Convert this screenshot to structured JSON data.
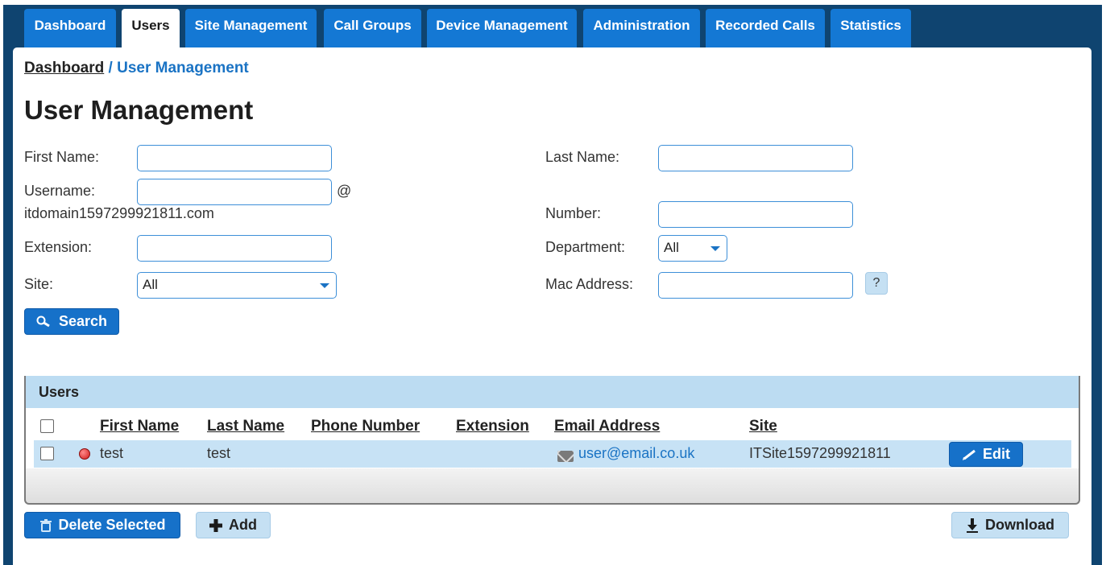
{
  "tabs": [
    {
      "label": "Dashboard",
      "active": false
    },
    {
      "label": "Users",
      "active": true
    },
    {
      "label": "Site Management",
      "active": false
    },
    {
      "label": "Call Groups",
      "active": false
    },
    {
      "label": "Device Management",
      "active": false
    },
    {
      "label": "Administration",
      "active": false
    },
    {
      "label": "Recorded Calls",
      "active": false
    },
    {
      "label": "Statistics",
      "active": false
    }
  ],
  "breadcrumb": {
    "root": "Dashboard",
    "separator": "/",
    "current": "User Management"
  },
  "page_title": "User Management",
  "form": {
    "first_name_label": "First Name:",
    "last_name_label": "Last Name:",
    "username_label": "Username:",
    "username_at": "@",
    "username_domain": "itdomain1597299921811.com",
    "number_label": "Number:",
    "extension_label": "Extension:",
    "department_label": "Department:",
    "department_value": "All",
    "site_label": "Site:",
    "site_value": "All",
    "mac_label": "Mac Address:",
    "help_label": "?",
    "search_label": "Search"
  },
  "grid": {
    "title": "Users",
    "columns": [
      "First Name",
      "Last Name",
      "Phone Number",
      "Extension",
      "Email Address",
      "Site"
    ],
    "rows": [
      {
        "first_name": "test",
        "last_name": "test",
        "phone": "",
        "extension": "",
        "email": "user@email.co.uk",
        "site": "ITSite1597299921811",
        "edit_label": "Edit"
      }
    ]
  },
  "actions": {
    "delete_label": "Delete Selected",
    "add_label": "Add",
    "download_label": "Download"
  },
  "colors": {
    "nav_bg": "#0f4470",
    "tab_blue": "#1478d4",
    "accent": "#1a73c4",
    "row_bg": "#c7e2f5"
  }
}
